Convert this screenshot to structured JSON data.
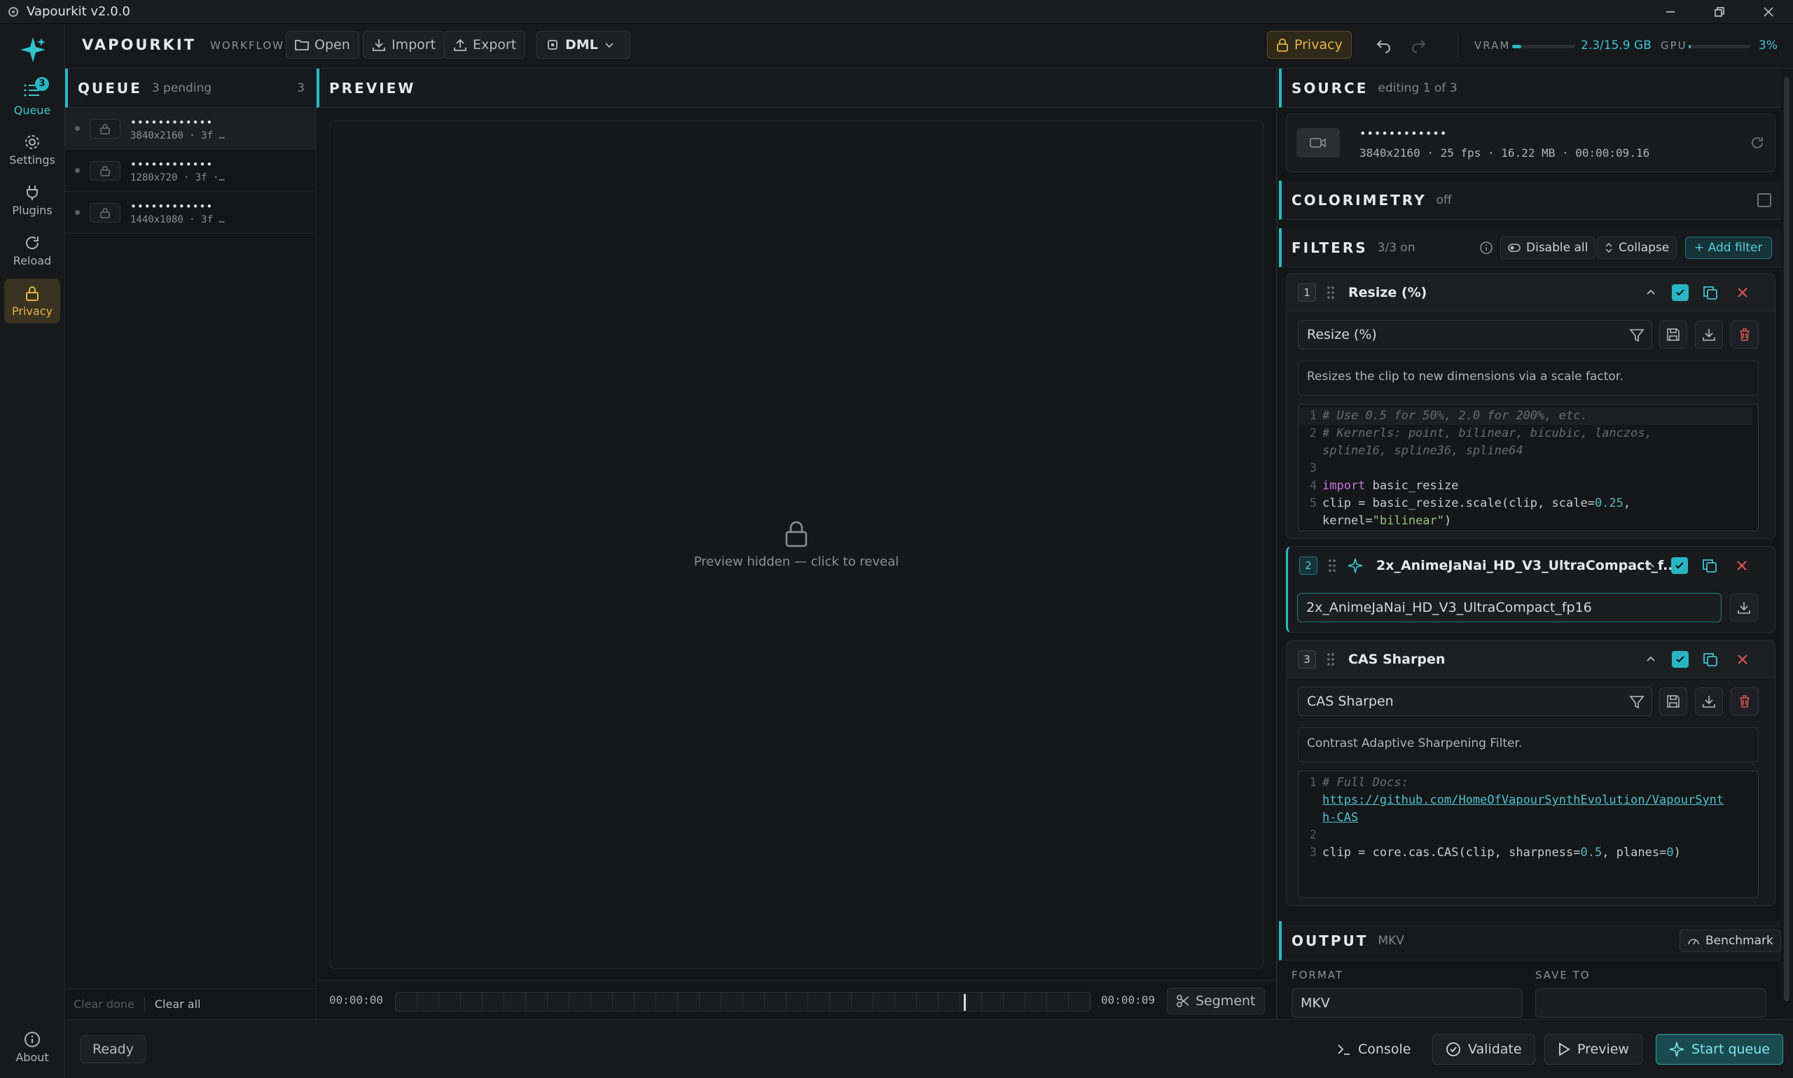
{
  "window": {
    "title": "Vapourkit v2.0.0"
  },
  "rail": {
    "queue_label": "Queue",
    "queue_badge": "3",
    "settings_label": "Settings",
    "plugins_label": "Plugins",
    "reload_label": "Reload",
    "privacy_label": "Privacy",
    "about_label": "About"
  },
  "header": {
    "brand": "VAPOURKIT",
    "workflow": "WORKFLOW",
    "open": "Open",
    "import": "Import",
    "export": "Export",
    "preset": "DML",
    "privacy": "Privacy",
    "vram_label": "VRAM",
    "vram_value": "2.3/15.9 GB",
    "vram_fraction": 0.145,
    "gpu_label": "GPU",
    "gpu_value": "3%",
    "gpu_fraction": 0.03
  },
  "queue": {
    "title": "QUEUE",
    "pending": "3 pending",
    "count": "3",
    "items": [
      {
        "name": "••••••••••••",
        "meta": "3840x2160 · 3f …"
      },
      {
        "name": "••••••••••••",
        "meta": "1280x720 · 3f ·…"
      },
      {
        "name": "••••••••••••",
        "meta": "1440x1080 · 3f …"
      }
    ],
    "clear_done": "Clear done",
    "clear_all": "Clear all"
  },
  "preview": {
    "title": "PREVIEW",
    "hidden_text": "Preview hidden — click to reveal",
    "time_start": "00:00:00",
    "time_end": "00:00:09",
    "playhead_fraction": 0.818,
    "segment": "Segment"
  },
  "source": {
    "title": "SOURCE",
    "editing": "editing 1 of 3",
    "name": "••••••••••••",
    "meta": "3840x2160 · 25 fps · 16.22 MB · 00:00:09.16"
  },
  "colorimetry": {
    "title": "COLORIMETRY",
    "state": "off"
  },
  "filters": {
    "title": "FILTERS",
    "state": "3/3 on",
    "disable_all": "Disable all",
    "collapse": "Collapse",
    "add_filter": "+ Add filter",
    "f1": {
      "num": "1",
      "name": "Resize (%)",
      "select": "Resize (%)",
      "desc": "Resizes the clip to new dimensions via a scale factor.",
      "c1": "# Use 0.5 for 50%, 2.0 for 200%, etc.",
      "c2a": "# Kernerls: point, bilinear, bicubic, lanczos,",
      "c2b": "spline16, spline36, spline64",
      "c4kw": "import",
      "c4b": " basic_resize",
      "c5a": "clip = basic_resize.scale(clip, scale=",
      "c5num": "0.25",
      "c5b": ",",
      "c5c": "kernel=",
      "c5str": "\"bilinear\"",
      "c5d": ")"
    },
    "f2": {
      "num": "2",
      "name": "2x_AnimeJaNai_HD_V3_UltraCompact_f...",
      "model": "2x_AnimeJaNai_HD_V3_UltraCompact_fp16"
    },
    "f3": {
      "num": "3",
      "name": "CAS Sharpen",
      "select": "CAS Sharpen",
      "desc": "Contrast Adaptive Sharpening Filter.",
      "c1": "# Full Docs:",
      "c1url_a": "https://github.com/HomeOfVapourSynthEvolution/VapourSynt",
      "c1url_b": "h-CAS",
      "c3a": "clip = core.cas.CAS(clip, sharpness=",
      "c3n1": "0.5",
      "c3b": ", planes=",
      "c3n2": "0",
      "c3c": ")"
    }
  },
  "output": {
    "title": "OUTPUT",
    "format_tag": "MKV",
    "benchmark": "Benchmark",
    "format_label": "FORMAT",
    "save_label": "SAVE TO",
    "format_value": "MKV"
  },
  "footer": {
    "status": "Ready",
    "console": "Console",
    "validate": "Validate",
    "preview": "Preview",
    "start": "Start queue"
  }
}
